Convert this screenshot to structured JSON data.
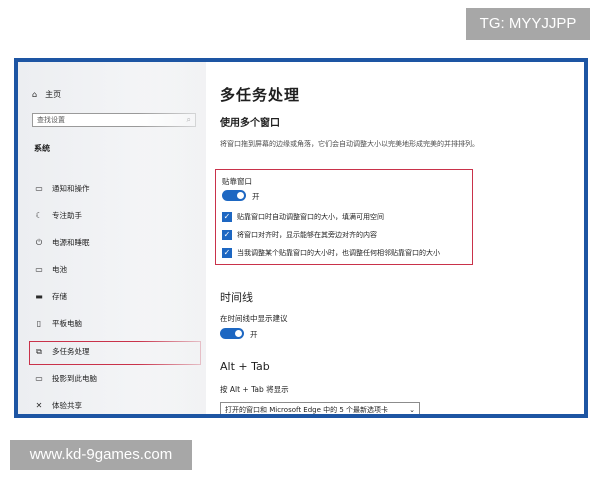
{
  "watermarks": {
    "top_right": "TG: MYYJJPP",
    "bottom_left": "www.kd-9games.com"
  },
  "sidebar": {
    "home_label": "主页",
    "search_placeholder": "查找设置",
    "section_heading": "系统",
    "items": [
      {
        "label": "通知和操作",
        "icon": "notification-icon"
      },
      {
        "label": "专注助手",
        "icon": "moon-icon"
      },
      {
        "label": "电源和睡眠",
        "icon": "power-icon"
      },
      {
        "label": "电池",
        "icon": "battery-icon"
      },
      {
        "label": "存储",
        "icon": "storage-icon"
      },
      {
        "label": "平板电脑",
        "icon": "tablet-icon"
      },
      {
        "label": "多任务处理",
        "icon": "multitask-icon",
        "selected": true
      },
      {
        "label": "投影到此电脑",
        "icon": "project-icon"
      },
      {
        "label": "体验共享",
        "icon": "share-icon"
      }
    ]
  },
  "main": {
    "title": "多任务处理",
    "section_windows": "使用多个窗口",
    "description": "将窗口拖到屏幕的边缘或角落，它们会自动调整大小以完美地形成完美的并排排列。",
    "snap": {
      "label": "贴靠窗口",
      "toggle_state": "开",
      "options": [
        {
          "label": "贴靠窗口时自动调整窗口的大小，填满可用空间",
          "checked": true
        },
        {
          "label": "将窗口对齐时，显示能够在其旁边对齐的内容",
          "checked": true
        },
        {
          "label": "当我调整某个贴靠窗口的大小时，也调整任何相邻贴靠窗口的大小",
          "checked": true
        }
      ]
    },
    "timeline": {
      "heading": "时间线",
      "option_label": "在时间线中显示建议",
      "toggle_state": "开"
    },
    "alt_tab": {
      "heading": "Alt + Tab",
      "label": "按 Alt + Tab 将显示",
      "selected": "打开的窗口和 Microsoft Edge 中的 5 个最新选项卡"
    }
  },
  "colors": {
    "accent": "#1d67c2",
    "highlight_outline": "#c9324a",
    "frame_border": "#1d55a3"
  }
}
